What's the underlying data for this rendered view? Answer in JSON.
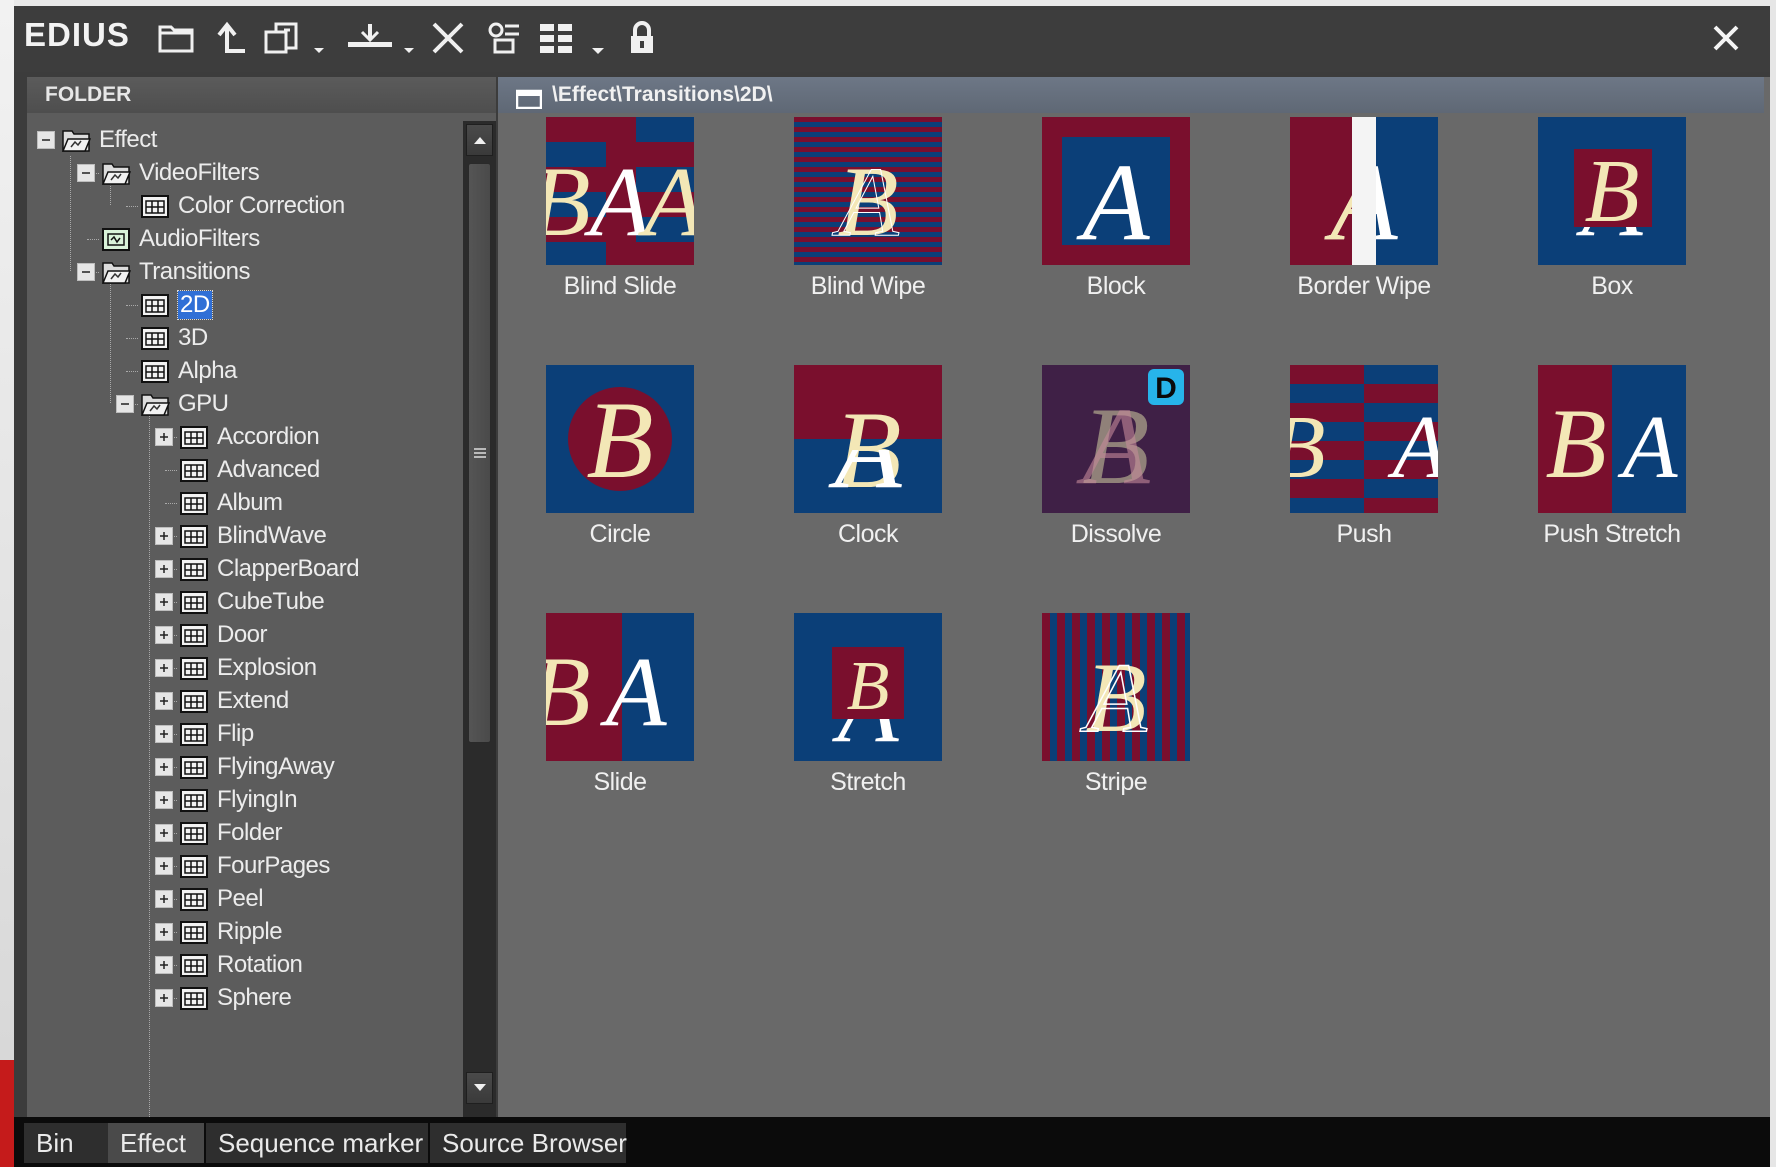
{
  "app": {
    "logo": "EDIUS",
    "toolbar": {
      "icons": [
        "open-folder-icon",
        "up-folder-icon",
        "copy-dropdown-icon",
        "apply-dropdown-icon",
        "delete-icon",
        "properties-icon",
        "view-dropdown-icon",
        "lock-icon"
      ],
      "close_icon": "close-icon"
    }
  },
  "folder_panel": {
    "header": "FOLDER",
    "tree": [
      {
        "label": "Effect",
        "level": 0,
        "expander": "minus",
        "icon": "open-folder"
      },
      {
        "label": "VideoFilters",
        "level": 1,
        "expander": "minus",
        "icon": "open-folder"
      },
      {
        "label": "Color Correction",
        "level": 2,
        "expander": "none",
        "icon": "grid"
      },
      {
        "label": "AudioFilters",
        "level": 1,
        "expander": "none",
        "icon": "audio"
      },
      {
        "label": "Transitions",
        "level": 1,
        "expander": "minus",
        "icon": "open-folder"
      },
      {
        "label": "2D",
        "level": 2,
        "expander": "none",
        "icon": "grid",
        "selected": true
      },
      {
        "label": "3D",
        "level": 2,
        "expander": "none",
        "icon": "grid"
      },
      {
        "label": "Alpha",
        "level": 2,
        "expander": "none",
        "icon": "grid"
      },
      {
        "label": "GPU",
        "level": 2,
        "expander": "minus",
        "icon": "open-folder"
      },
      {
        "label": "Accordion",
        "level": 3,
        "expander": "plus",
        "icon": "grid"
      },
      {
        "label": "Advanced",
        "level": 3,
        "expander": "none",
        "icon": "grid"
      },
      {
        "label": "Album",
        "level": 3,
        "expander": "none",
        "icon": "grid"
      },
      {
        "label": "BlindWave",
        "level": 3,
        "expander": "plus",
        "icon": "grid"
      },
      {
        "label": "ClapperBoard",
        "level": 3,
        "expander": "plus",
        "icon": "grid"
      },
      {
        "label": "CubeTube",
        "level": 3,
        "expander": "plus",
        "icon": "grid"
      },
      {
        "label": "Door",
        "level": 3,
        "expander": "plus",
        "icon": "grid"
      },
      {
        "label": "Explosion",
        "level": 3,
        "expander": "plus",
        "icon": "grid"
      },
      {
        "label": "Extend",
        "level": 3,
        "expander": "plus",
        "icon": "grid"
      },
      {
        "label": "Flip",
        "level": 3,
        "expander": "plus",
        "icon": "grid"
      },
      {
        "label": "FlyingAway",
        "level": 3,
        "expander": "plus",
        "icon": "grid"
      },
      {
        "label": "FlyingIn",
        "level": 3,
        "expander": "plus",
        "icon": "grid"
      },
      {
        "label": "Folder",
        "level": 3,
        "expander": "plus",
        "icon": "grid"
      },
      {
        "label": "FourPages",
        "level": 3,
        "expander": "plus",
        "icon": "grid"
      },
      {
        "label": "Peel",
        "level": 3,
        "expander": "plus",
        "icon": "grid"
      },
      {
        "label": "Ripple",
        "level": 3,
        "expander": "plus",
        "icon": "grid"
      },
      {
        "label": "Rotation",
        "level": 3,
        "expander": "plus",
        "icon": "grid"
      },
      {
        "label": "Sphere",
        "level": 3,
        "expander": "plus",
        "icon": "grid"
      }
    ]
  },
  "content_panel": {
    "path": "\\Effect\\Transitions\\2D\\",
    "items": [
      {
        "label": "Blind Slide",
        "thumb": "blind-slide"
      },
      {
        "label": "Blind Wipe",
        "thumb": "blind-wipe"
      },
      {
        "label": "Block",
        "thumb": "block"
      },
      {
        "label": "Border Wipe",
        "thumb": "border-wipe"
      },
      {
        "label": "Box",
        "thumb": "box"
      },
      {
        "label": "Circle",
        "thumb": "circle"
      },
      {
        "label": "Clock",
        "thumb": "clock"
      },
      {
        "label": "Dissolve",
        "thumb": "dissolve",
        "badge": "D"
      },
      {
        "label": "Push",
        "thumb": "push"
      },
      {
        "label": "Push Stretch",
        "thumb": "push-stretch"
      },
      {
        "label": "Slide",
        "thumb": "slide"
      },
      {
        "label": "Stretch",
        "thumb": "stretch"
      },
      {
        "label": "Stripe",
        "thumb": "stripe"
      }
    ]
  },
  "tabs": [
    {
      "label": "Bin",
      "active": false
    },
    {
      "label": "Effect",
      "active": true
    },
    {
      "label": "Sequence marker",
      "active": false
    },
    {
      "label": "Source Browser",
      "active": false
    }
  ],
  "colors": {
    "maroon": "#7a0f2d",
    "blue": "#0b3f78",
    "cream": "#f3e7b6",
    "selection": "#2f6fd6",
    "badge": "#27b4ea"
  }
}
